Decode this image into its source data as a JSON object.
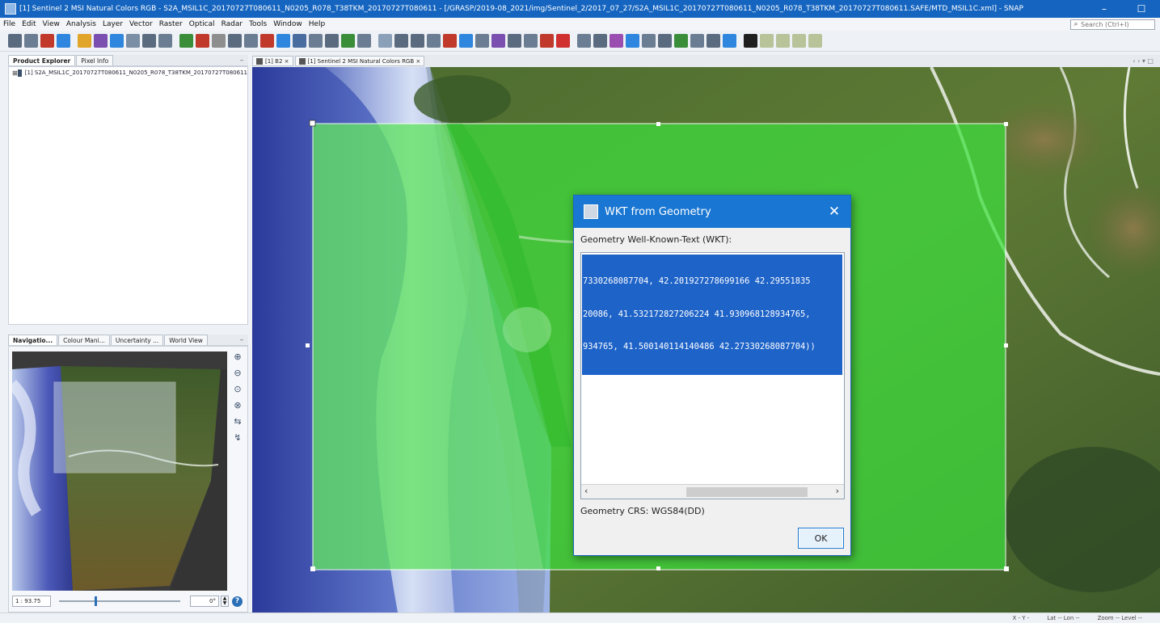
{
  "window": {
    "title": "[1] Sentinel 2 MSI Natural Colors RGB - S2A_MSIL1C_20170727T080611_N0205_R078_T38TKM_20170727T080611 - [/GRASP/2019-08_2021/img/Sentinel_2/2017_07_27/S2A_MSIL1C_20170727T080611_N0205_R078_T38TKM_20170727T080611.SAFE/MTD_MSIL1C.xml] - SNAP",
    "controls": {
      "minimize": "–",
      "maximize": "☐"
    }
  },
  "menu": {
    "items": [
      "File",
      "Edit",
      "View",
      "Analysis",
      "Layer",
      "Vector",
      "Raster",
      "Optical",
      "Radar",
      "Tools",
      "Window",
      "Help"
    ],
    "search_placeholder": "Search (Ctrl+I)"
  },
  "toolbar": {
    "colors": [
      "#5a6b80",
      "#6b7d92",
      "#c0392b",
      "#2e86de",
      "#e1a52a",
      "#7a4fb0",
      "#2e86de",
      "#7a8ea6",
      "#5a6b80",
      "#6b7d92",
      "#3a8e3a",
      "#c0392b",
      "#8e8e8e",
      "#5a6b80",
      "#6b7d92",
      "#c0392b",
      "#2e86de",
      "#4a6da0",
      "#6b7d92",
      "#5a6b80",
      "#3a8e3a",
      "#6b7d92",
      "#8aa0b8",
      "#5a6b80",
      "#5a6b80",
      "#6b7d92",
      "#c0392b",
      "#2e86de",
      "#6b7d92",
      "#7a4fb0",
      "#5a6b80",
      "#6b7d92",
      "#c0392b",
      "#d03030",
      "#6b7d92",
      "#5a6b80",
      "#9a4fb0",
      "#2e86de",
      "#6b7d92",
      "#5a6b80",
      "#3a8e3a",
      "#6b7d92",
      "#5a6b80",
      "#2e86de",
      "#1f1f1f",
      "#b8c39a",
      "#b8c39a",
      "#b8c39a",
      "#b8c39a"
    ]
  },
  "left_top": {
    "tabs": [
      "Product Explorer",
      "Pixel Info"
    ],
    "product_label": "[1] S2A_MSIL1C_20170727T080611_N0205_R078_T38TKM_20170727T080611"
  },
  "left_bottom": {
    "tabs": [
      "Navigatio...",
      "Colour Mani...",
      "Uncertainty ...",
      "World View"
    ],
    "scale": "1 : 93.75",
    "angle": "0°"
  },
  "view": {
    "tabs": [
      "[1] B2",
      "[1] Sentinel 2 MSI Natural Colors RGB"
    ]
  },
  "dialog": {
    "title": "WKT from Geometry",
    "label": "Geometry Well-Known-Text (WKT):",
    "wkt_lines": [
      "7330268087704, 42.201927278699166 42.29551835",
      "20086, 41.532172827206224 41.930968128934765,",
      "934765, 41.500140114140486 42.27330268087704))"
    ],
    "crs": "Geometry CRS: WGS84(DD)",
    "ok_label": "OK"
  },
  "status": {
    "items": [
      "X  -  Y  -",
      "Lat  --  Lon  --",
      "Zoom --  Level --"
    ]
  },
  "colors": {
    "titlebar": "#1565c0",
    "dialog_titlebar": "#1976d2",
    "selection": "#1e63c8",
    "overlay_green": "#3de03d"
  }
}
